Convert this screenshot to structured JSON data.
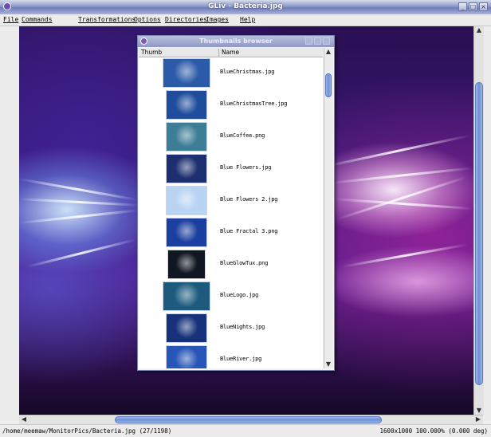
{
  "window": {
    "title": "GLiv - Bacteria.jpg",
    "app_icon": "gliv-icon"
  },
  "menu": [
    {
      "label": "File"
    },
    {
      "label": "Commands"
    },
    {
      "label": "Transformations"
    },
    {
      "label": "Options"
    },
    {
      "label": "Directories"
    },
    {
      "label": "Images"
    },
    {
      "label": "Help"
    }
  ],
  "browser": {
    "title": "Thumbnails browser",
    "col_thumb": "Thumb",
    "col_name": "Name",
    "items": [
      {
        "name": "BlueChristmas.jpg",
        "color": "#2a5aa8"
      },
      {
        "name": "BlueChristmasTree.jpg",
        "color": "#1f4d9c"
      },
      {
        "name": "BlueCoffee.png",
        "color": "#3d7e96"
      },
      {
        "name": "Blue Flowers.jpg",
        "color": "#1e2f70"
      },
      {
        "name": "Blue Flowers 2.jpg",
        "color": "#b9d4f2"
      },
      {
        "name": "Blue Fractal 3.png",
        "color": "#1b3f9e"
      },
      {
        "name": "BlueGlowTux.png",
        "color": "#111722"
      },
      {
        "name": "BlueLogo.jpg",
        "color": "#1d5a7e"
      },
      {
        "name": "BlueNights.jpg",
        "color": "#17327a"
      },
      {
        "name": "BlueRiver.jpg",
        "color": "#2856b8"
      }
    ]
  },
  "status": {
    "path": "/home/meemaw/MonitorPics/Bacteria.jpg (27/1198)",
    "info": "1600x1000  100.000% (0.000 deg)"
  },
  "colors": {
    "accent": "#6e8ed4",
    "titlebar": "#8b98c8"
  }
}
